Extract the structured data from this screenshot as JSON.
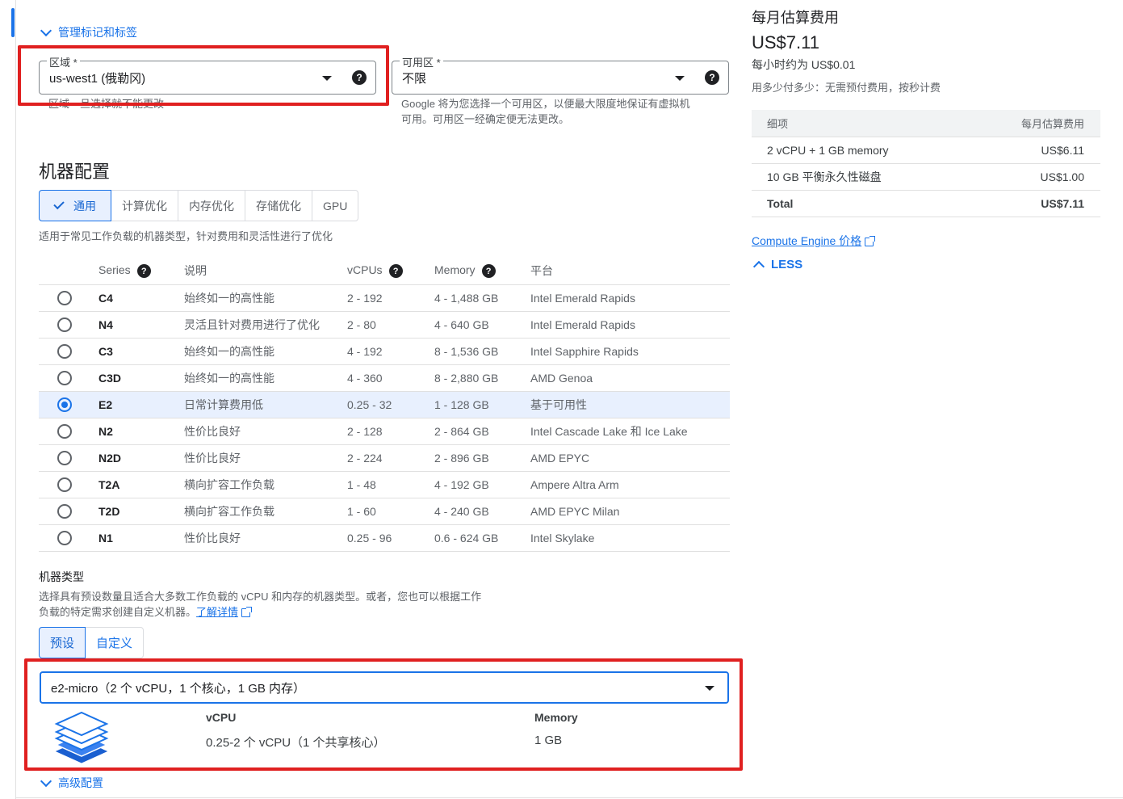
{
  "labels_section": {
    "label": "管理标记和标签"
  },
  "region": {
    "label": "区域 *",
    "value": "us-west1 (俄勒冈)",
    "hint": "区域一旦选择就不能更改"
  },
  "zone": {
    "label": "可用区 *",
    "value": "不限",
    "hint_line1": "Google 将为您选择一个可用区，以便最大限度地保证有虚拟机",
    "hint_line2": "可用。可用区一经确定便无法更改。"
  },
  "machine_config": {
    "title": "机器配置",
    "tabs": [
      "通用",
      "计算优化",
      "内存优化",
      "存储优化",
      "GPU"
    ],
    "description": "适用于常见工作负载的机器类型，针对费用和灵活性进行了优化"
  },
  "series_table": {
    "headers": {
      "series": "Series",
      "desc": "说明",
      "vcpus": "vCPUs",
      "memory": "Memory",
      "platform": "平台"
    },
    "rows": [
      {
        "series": "C4",
        "desc": "始终如一的高性能",
        "vcpus": "2 - 192",
        "memory": "4 - 1,488 GB",
        "platform": "Intel Emerald Rapids",
        "selected": false
      },
      {
        "series": "N4",
        "desc": "灵活且针对费用进行了优化",
        "vcpus": "2 - 80",
        "memory": "4 - 640 GB",
        "platform": "Intel Emerald Rapids",
        "selected": false
      },
      {
        "series": "C3",
        "desc": "始终如一的高性能",
        "vcpus": "4 - 192",
        "memory": "8 - 1,536 GB",
        "platform": "Intel Sapphire Rapids",
        "selected": false
      },
      {
        "series": "C3D",
        "desc": "始终如一的高性能",
        "vcpus": "4 - 360",
        "memory": "8 - 2,880 GB",
        "platform": "AMD Genoa",
        "selected": false
      },
      {
        "series": "E2",
        "desc": "日常计算费用低",
        "vcpus": "0.25 - 32",
        "memory": "1 - 128 GB",
        "platform": "基于可用性",
        "selected": true
      },
      {
        "series": "N2",
        "desc": "性价比良好",
        "vcpus": "2 - 128",
        "memory": "2 - 864 GB",
        "platform": "Intel Cascade Lake 和 Ice Lake",
        "selected": false
      },
      {
        "series": "N2D",
        "desc": "性价比良好",
        "vcpus": "2 - 224",
        "memory": "2 - 896 GB",
        "platform": "AMD EPYC",
        "selected": false
      },
      {
        "series": "T2A",
        "desc": "横向扩容工作负载",
        "vcpus": "1 - 48",
        "memory": "4 - 192 GB",
        "platform": "Ampere Altra Arm",
        "selected": false
      },
      {
        "series": "T2D",
        "desc": "横向扩容工作负载",
        "vcpus": "1 - 60",
        "memory": "4 - 240 GB",
        "platform": "AMD EPYC Milan",
        "selected": false
      },
      {
        "series": "N1",
        "desc": "性价比良好",
        "vcpus": "0.25 - 96",
        "memory": "0.6 - 624 GB",
        "platform": "Intel Skylake",
        "selected": false
      }
    ]
  },
  "machine_type": {
    "title": "机器类型",
    "desc_line1": "选择具有预设数量且适合大多数工作负载的 vCPU 和内存的机器类型。或者，您也可以根据工作",
    "desc_line2": "负载的特定需求创建自定义机器。",
    "learn_more": "了解详情",
    "tabs": [
      "预设",
      "自定义"
    ],
    "selected": "e2-micro（2 个 vCPU，1 个核心，1 GB 内存）",
    "vcpu_label": "vCPU",
    "vcpu_value": "0.25-2 个 vCPU（1 个共享核心）",
    "memory_label": "Memory",
    "memory_value": "1 GB"
  },
  "advanced": {
    "label": "高级配置"
  },
  "cost": {
    "title": "每月估算费用",
    "amount": "US$7.11",
    "hourly": "每小时约为 US$0.01",
    "note": "用多少付多少：无需预付费用，按秒计费",
    "table_header_item": "细项",
    "table_header_cost": "每月估算费用",
    "rows": [
      {
        "item": "2 vCPU + 1 GB memory",
        "cost": "US$6.11"
      },
      {
        "item": "10 GB 平衡永久性磁盘",
        "cost": "US$1.00"
      }
    ],
    "total_label": "Total",
    "total_value": "US$7.11",
    "pricing_link": "Compute Engine 价格",
    "less_label": "LESS"
  },
  "colors": {
    "accent": "#1a73e8",
    "highlight": "#e02020",
    "selected_row": "#e8f0fe"
  }
}
